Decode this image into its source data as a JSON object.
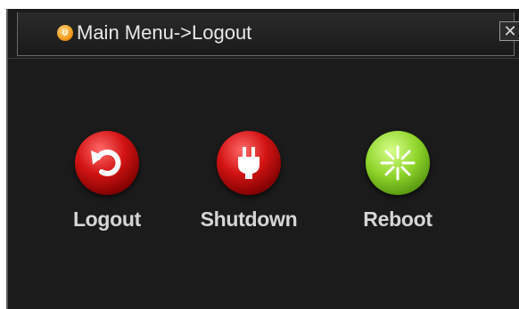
{
  "window": {
    "title": "Main Menu->Logout",
    "close_label": "✕"
  },
  "actions": [
    {
      "label": "Logout",
      "icon": "undo-arrow-icon",
      "color": "#c81010"
    },
    {
      "label": "Shutdown",
      "icon": "power-plug-icon",
      "color": "#c81010"
    },
    {
      "label": "Reboot",
      "icon": "restart-burst-icon",
      "color": "#7cc21e"
    }
  ],
  "colors": {
    "background": "#1b1b1b",
    "title_text": "#e8e8e8",
    "label_text": "#d6d6d6",
    "title_icon": "#f29a1c"
  }
}
